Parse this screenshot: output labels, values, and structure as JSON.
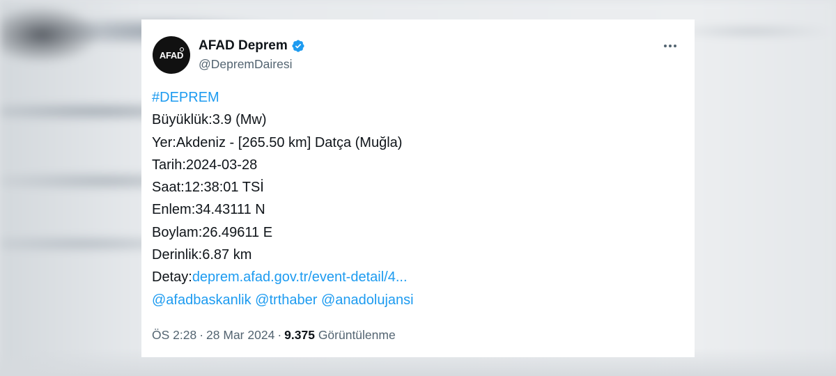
{
  "tweet": {
    "author": {
      "avatar_text": "AFAD",
      "display_name": "AFAD Deprem",
      "handle": "@DepremDairesi",
      "verified": true
    },
    "more_icon": "more-horizontal-icon",
    "hashtag": "#DEPREM",
    "lines": [
      "Büyüklük:3.9 (Mw)",
      "Yer:Akdeniz - [265.50 km] Datça (Muğla)",
      "Tarih:2024-03-28",
      "Saat:12:38:01 TSİ",
      "Enlem:34.43111 N",
      "Boylam:26.49611 E",
      "Derinlik:6.87 km"
    ],
    "detail_label": "Detay:",
    "detail_link": "deprem.afad.gov.tr/event-detail/4...",
    "mentions": [
      "@afadbaskanlik",
      "@trthaber",
      "@anadolujansi"
    ],
    "time": "ÖS 2:28",
    "date": "28 Mar 2024",
    "separator": "·",
    "views_count": "9.375",
    "views_label": "Görüntülenme"
  },
  "colors": {
    "link": "#1d9bf0",
    "text": "#0f1419",
    "secondary": "#536471",
    "verified": "#1d9bf0"
  }
}
